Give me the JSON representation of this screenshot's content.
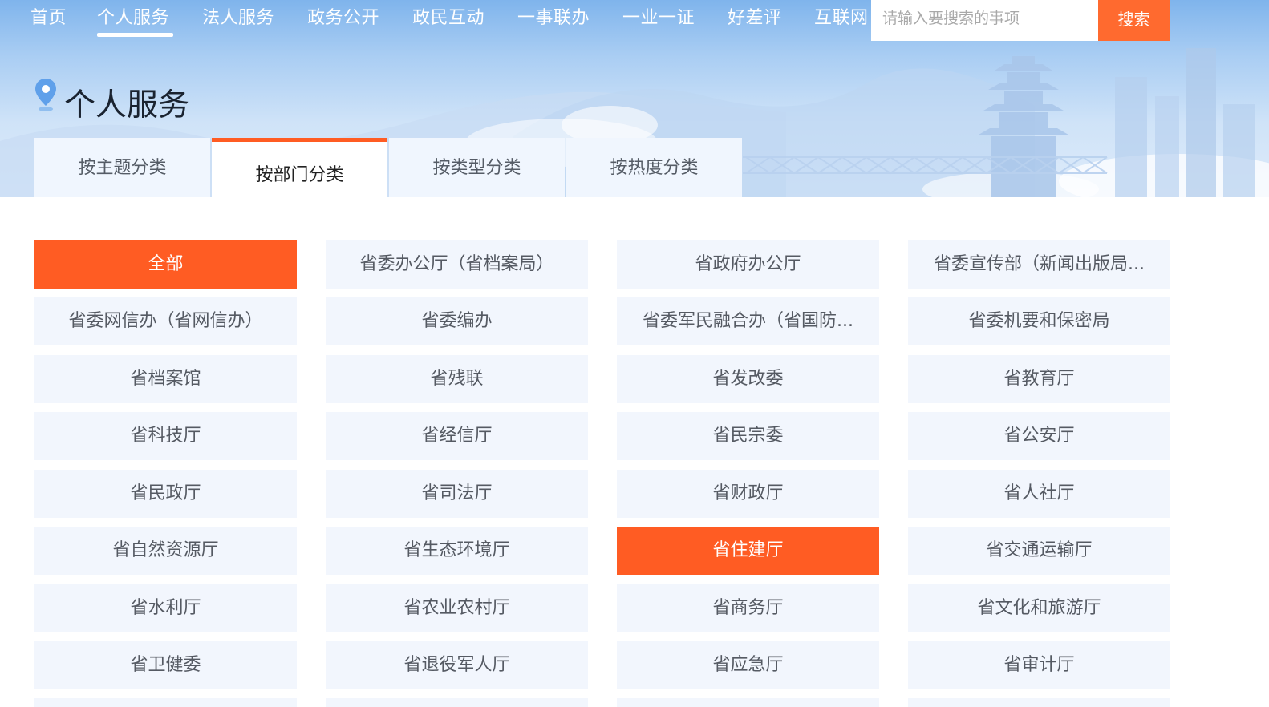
{
  "nav": {
    "items": [
      "首页",
      "个人服务",
      "法人服务",
      "政务公开",
      "政民互动",
      "一事联办",
      "一业一证",
      "好差评",
      "互联网"
    ],
    "active_index": 1
  },
  "search": {
    "placeholder": "请输入要搜索的事项",
    "button_label": "搜索"
  },
  "page": {
    "title": "个人服务"
  },
  "tabs": {
    "items": [
      "按主题分类",
      "按部门分类",
      "按类型分类",
      "按热度分类"
    ],
    "active_index": 1
  },
  "departments": {
    "items": [
      "全部",
      "省委办公厅（省档案局）",
      "省政府办公厅",
      "省委宣传部（新闻出版局...",
      "省委网信办（省网信办）",
      "省委编办",
      "省委军民融合办（省国防...",
      "省委机要和保密局",
      "省档案馆",
      "省残联",
      "省发改委",
      "省教育厅",
      "省科技厅",
      "省经信厅",
      "省民宗委",
      "省公安厅",
      "省民政厅",
      "省司法厅",
      "省财政厅",
      "省人社厅",
      "省自然资源厅",
      "省生态环境厅",
      "省住建厅",
      "省交通运输厅",
      "省水利厅",
      "省农业农村厅",
      "省商务厅",
      "省文化和旅游厅",
      "省卫健委",
      "省退役军人厅",
      "省应急厅",
      "省审计厅"
    ],
    "highlighted_indices": [
      0,
      22
    ]
  },
  "colors": {
    "accent": "#ff5c23",
    "cell_background": "#f2f6fd",
    "tab_background": "#f0f6fe"
  }
}
